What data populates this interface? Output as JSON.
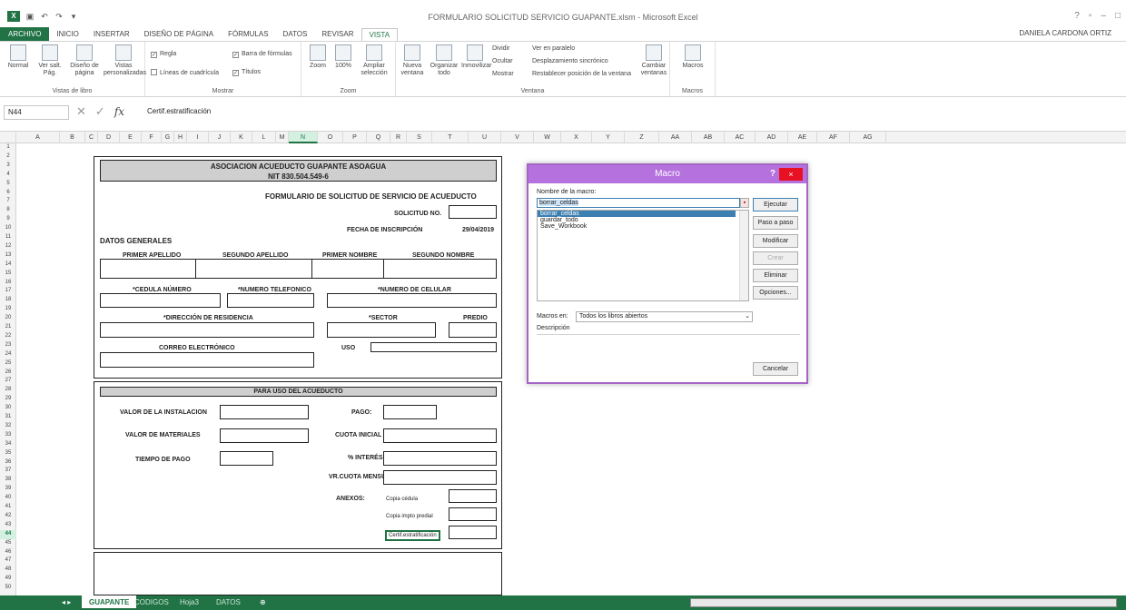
{
  "window": {
    "title": "FORMULARIO SOLICITUD SERVICIO GUAPANTE.xlsm - Microsoft Excel",
    "user": "DANIELA CARDONA ORTIZ",
    "controls": [
      "?",
      "▫",
      "–",
      "□"
    ]
  },
  "ribbon": {
    "tabs": [
      {
        "id": "archivo",
        "label": "ARCHIVO"
      },
      {
        "id": "inicio",
        "label": "INICIO"
      },
      {
        "id": "insertar",
        "label": "INSERTAR"
      },
      {
        "id": "diseno",
        "label": "DISEÑO DE PÁGINA"
      },
      {
        "id": "formulas",
        "label": "FÓRMULAS"
      },
      {
        "id": "datos",
        "label": "DATOS"
      },
      {
        "id": "revisar",
        "label": "REVISAR"
      },
      {
        "id": "vista",
        "label": "VISTA"
      }
    ],
    "vistas": {
      "normal": "Normal",
      "versalt": "Ver salt. Pág.",
      "diseno": "Diseño de página",
      "personalizadas": "Vistas personalizadas",
      "group": "Vistas de libro"
    },
    "mostrar": {
      "regla": "Regla",
      "barra": "Barra de fórmulas",
      "lineas": "Líneas de cuadrícula",
      "titulos": "Títulos",
      "group": "Mostrar"
    },
    "zoom": {
      "zoom": "Zoom",
      "z100": "100%",
      "ampliar": "Ampliar selección",
      "group": "Zoom"
    },
    "ventana": {
      "nueva": "Nueva ventana",
      "organizar": "Organizar todo",
      "inmovilizar": "Inmovilizar",
      "dividir": "Dividir",
      "ocultar": "Ocultar",
      "mostrar": "Mostrar",
      "paralelo": "Ver en paralelo",
      "sincronico": "Desplazamiento sincrónico",
      "restablecer": "Restablecer posición de la ventana",
      "cambiar": "Cambiar ventanas",
      "group": "Ventana"
    },
    "macros": {
      "macros": "Macros",
      "group": "Macros"
    }
  },
  "formula_bar": {
    "name_box": "N44",
    "fx": "fx",
    "value": "Certif.estratificación"
  },
  "columns": [
    "A",
    "B",
    "C",
    "D",
    "E",
    "F",
    "G",
    "H",
    "I",
    "J",
    "K",
    "L",
    "M",
    "N",
    "O",
    "P",
    "Q",
    "R",
    "S",
    "T",
    "U",
    "V",
    "W",
    "X",
    "Y",
    "Z",
    "AA",
    "AB",
    "AC",
    "AD",
    "AE",
    "AF",
    "AG"
  ],
  "rows": [
    "1",
    "2",
    "3",
    "4",
    "5",
    "6",
    "7",
    "8",
    "9",
    "10",
    "11",
    "12",
    "13",
    "14",
    "15",
    "16",
    "17",
    "18",
    "19",
    "20",
    "21",
    "22",
    "23",
    "24",
    "25",
    "26",
    "27",
    "28",
    "29",
    "30",
    "31",
    "32",
    "33",
    "34",
    "35",
    "36",
    "37",
    "38",
    "39",
    "40",
    "41",
    "42",
    "43",
    "44",
    "45",
    "46",
    "47",
    "48",
    "49",
    "50"
  ],
  "form": {
    "org": "ASOCIACION ACUEDUCTO GUAPANTE ASOAGUA",
    "nit": "NIT 830.504.549-6",
    "title": "FORMULARIO DE SOLICITUD DE SERVICIO DE ACUEDUCTO",
    "solicitud": "SOLICITUD NO.",
    "fecha_label": "FECHA DE INSCRIPCIÓN",
    "fecha": "29/04/2019",
    "datos": "DATOS GENERALES",
    "primer_apellido": "PRIMER APELLIDO",
    "segundo_apellido": "SEGUNDO APELLIDO",
    "primer_nombre": "PRIMER NOMBRE",
    "segundo_nombre": "SEGUNDO NOMBRE",
    "cedula": "*CEDULA NÚMERO",
    "telefono": "*NUMERO TELEFONICO",
    "celular": "*NUMERO DE CELULAR",
    "direccion": "*DIRECCIÓN DE RESIDENCIA",
    "sector": "*SECTOR",
    "predio": "PREDIO",
    "correo": "CORREO ELECTRÓNICO",
    "uso": "USO",
    "para_uso": "PARA USO DEL ACUEDUCTO",
    "valor_inst": "VALOR DE LA INSTALACION",
    "pago": "PAGO:",
    "valor_mat": "VALOR DE MATERIALES",
    "cuota_ini": "CUOTA INICIAL",
    "tiempo": "TIEMPO DE PAGO",
    "interes": "% INTERÉS",
    "cuota_mens": "VR.CUOTA MENSUAL",
    "anexos": "ANEXOS:",
    "copia_cedula": "Copia cédula",
    "copia_predial": "Copia impto predial",
    "certif": "Certif.estratificación"
  },
  "dialog": {
    "title": "Macro",
    "help": "?",
    "close": "×",
    "name_label": "Nombre de la macro:",
    "name_value": "borrar_celdas",
    "list": [
      "borrar_celdas",
      "guardar_todo",
      "Save_Workbook"
    ],
    "selected": 0,
    "buttons": {
      "run": "Ejecutar",
      "step": "Paso a paso",
      "edit": "Modificar",
      "create": "Crear",
      "delete": "Eliminar",
      "options": "Opciones..."
    },
    "macros_in_label": "Macros en:",
    "macros_in_value": "Todos los libros abiertos",
    "desc_label": "Descripción",
    "cancel": "Cancelar"
  },
  "sheets": [
    {
      "label": "GUAPANTE",
      "active": true
    },
    {
      "label": "CODIGOS",
      "active": false
    },
    {
      "label": "Hoja3",
      "active": false
    },
    {
      "label": "DATOS",
      "active": false
    }
  ],
  "colors": {
    "excel_green": "#217346",
    "dialog_purple": "#b571dd"
  }
}
